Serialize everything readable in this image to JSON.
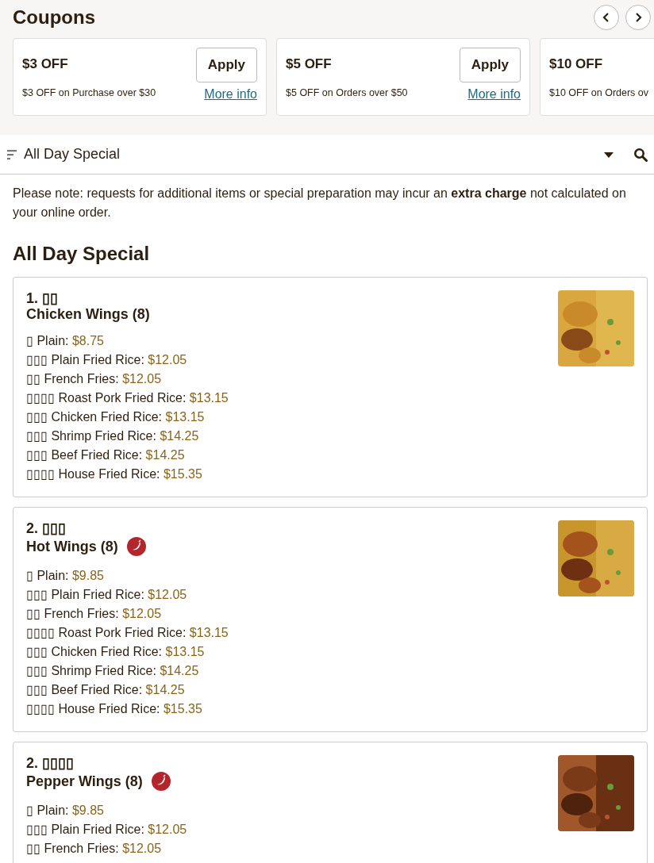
{
  "coupons_section": {
    "title": "Coupons"
  },
  "coupons": [
    {
      "title": "$3 OFF",
      "description": "$3 OFF on Purchase over $30",
      "apply_label": "Apply",
      "more_info": "More info"
    },
    {
      "title": "$5 OFF",
      "description": "$5 OFF on Orders over $50",
      "apply_label": "Apply",
      "more_info": "More info"
    },
    {
      "title": "$10 OFF",
      "description": "$10 OFF on Orders ov"
    }
  ],
  "category_bar": {
    "selected_category": "All Day Special"
  },
  "notice": "Please note: requests for additional items or special preparation may incur an **extra charge** not calculated on your online order.",
  "section_title": "All Day Special",
  "items": [
    {
      "number": "1. ▯▯",
      "name": "Chicken Wings (8)",
      "spicy": false,
      "options": [
        {
          "label": "▯ Plain:",
          "price": "$8.75"
        },
        {
          "label": "▯▯▯ Plain Fried Rice:",
          "price": "$12.05"
        },
        {
          "label": "▯▯ French Fries:",
          "price": "$12.05"
        },
        {
          "label": "▯▯▯▯ Roast Pork Fried Rice:",
          "price": "$13.15"
        },
        {
          "label": "▯▯▯ Chicken Fried Rice:",
          "price": "$13.15"
        },
        {
          "label": "▯▯▯ Shrimp Fried Rice:",
          "price": "$14.25"
        },
        {
          "label": "▯▯▯ Beef Fried Rice:",
          "price": "$14.25"
        },
        {
          "label": "▯▯▯▯ House Fried Rice:",
          "price": "$15.35"
        }
      ]
    },
    {
      "number": "2. ▯▯▯",
      "name": "Hot Wings (8)",
      "spicy": true,
      "options": [
        {
          "label": "▯ Plain:",
          "price": "$9.85"
        },
        {
          "label": "▯▯▯ Plain Fried Rice:",
          "price": "$12.05"
        },
        {
          "label": "▯▯ French Fries:",
          "price": "$12.05"
        },
        {
          "label": "▯▯▯▯ Roast Pork Fried Rice:",
          "price": "$13.15"
        },
        {
          "label": "▯▯▯ Chicken Fried Rice:",
          "price": "$13.15"
        },
        {
          "label": "▯▯▯ Shrimp Fried Rice:",
          "price": "$14.25"
        },
        {
          "label": "▯▯▯ Beef Fried Rice:",
          "price": "$14.25"
        },
        {
          "label": "▯▯▯▯ House Fried Rice:",
          "price": "$15.35"
        }
      ]
    },
    {
      "number": "2. ▯▯▯▯",
      "name": "Pepper Wings (8)",
      "spicy": true,
      "options": [
        {
          "label": "▯ Plain:",
          "price": "$9.85"
        },
        {
          "label": "▯▯▯ Plain Fried Rice:",
          "price": "$12.05"
        },
        {
          "label": "▯▯ French Fries:",
          "price": "$12.05"
        }
      ]
    }
  ]
}
